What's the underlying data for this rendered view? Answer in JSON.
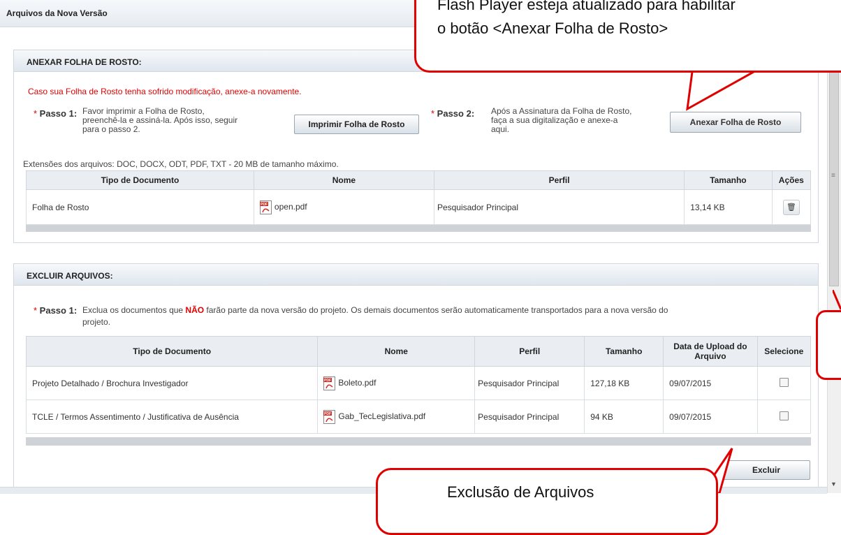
{
  "header": {
    "title": "Arquivos da Nova Versão"
  },
  "folha": {
    "title": "ANEXAR FOLHA DE ROSTO:",
    "warning": "Caso sua Folha de Rosto tenha sofrido modificação, anexe-a novamente.",
    "passo1": {
      "label": "Passo 1:",
      "desc": [
        "Favor imprimir a Folha de Rosto,",
        "preenchê-la e assiná-la. Após isso, seguir",
        "para o passo 2."
      ],
      "button": "Imprimir Folha de Rosto"
    },
    "passo2": {
      "label": "Passo 2:",
      "desc": [
        "Após a Assinatura da Folha de Rosto,",
        "faça a sua digitalização e anexe-a",
        "aqui."
      ],
      "button": "Anexar Folha de Rosto"
    },
    "extensions": "Extensões dos arquivos: DOC, DOCX, ODT, PDF, TXT - 20 MB de tamanho máximo.",
    "columns": [
      "Tipo de Documento",
      "Nome",
      "Perfil",
      "Tamanho",
      "Ações"
    ],
    "rows": [
      {
        "tipo": "Folha de Rosto",
        "nome": "open.pdf",
        "perfil": "Pesquisador Principal",
        "tamanho": "13,14 KB",
        "acao_icon": "trash-icon"
      }
    ]
  },
  "excluir": {
    "title": "EXCLUIR ARQUIVOS:",
    "passo1": {
      "label": "Passo 1:",
      "desc_before": "Exclua os documentos que ",
      "desc_highlight": "NÃO",
      "desc_after": " farão parte da nova versão do projeto. Os demais documentos serão automaticamente transportados para a nova versão do",
      "desc_line2": "projeto."
    },
    "columns": [
      "Tipo de Documento",
      "Nome",
      "Perfil",
      "Tamanho",
      "Data de Upload do Arquivo",
      "Selecione"
    ],
    "rows": [
      {
        "tipo": "Projeto Detalhado / Brochura Investigador",
        "nome": "Boleto.pdf",
        "perfil": "Pesquisador Principal",
        "tamanho": "127,18 KB",
        "data": "09/07/2015",
        "selected": false
      },
      {
        "tipo": "TCLE / Termos Assentimento / Justificativa de Ausência",
        "nome": "Gab_TecLegislativa.pdf",
        "perfil": "Pesquisador Principal",
        "tamanho": "94 KB",
        "data": "09/07/2015",
        "selected": false
      }
    ],
    "button": "Excluir"
  },
  "callouts": {
    "top": [
      "Flash Player esteja atualizado para habilitar",
      "o botão <Anexar Folha de Rosto>"
    ],
    "bottom": "Exclusão de Arquivos"
  },
  "colors": {
    "accent_red": "#e00000",
    "header_bg": "#e6ebf1"
  },
  "icons": {
    "file": "pdf-icon",
    "delete": "trash-icon",
    "checkbox": "checkbox"
  }
}
